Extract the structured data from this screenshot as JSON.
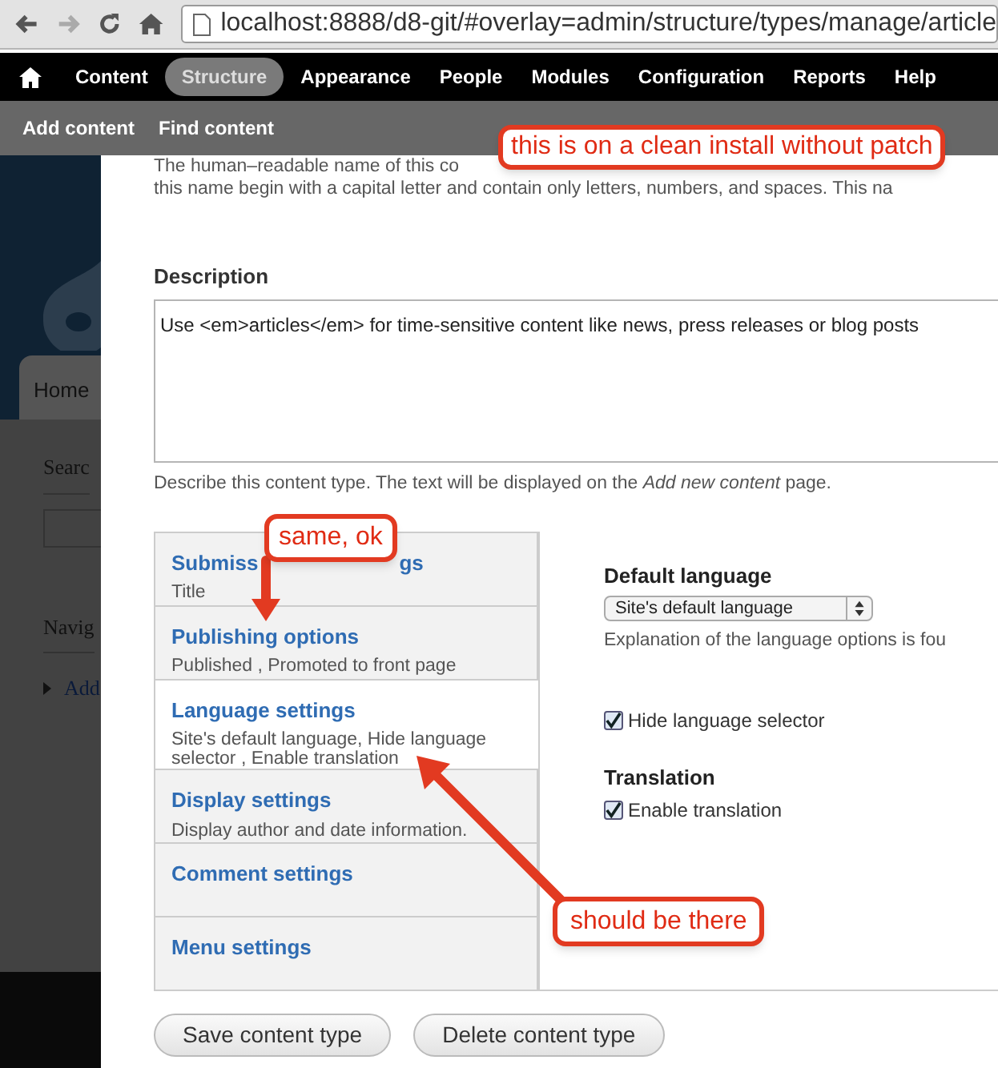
{
  "browser": {
    "url": "localhost:8888/d8-git/#overlay=admin/structure/types/manage/article"
  },
  "toolbar": {
    "items": [
      {
        "label": "Content",
        "selected": false
      },
      {
        "label": "Structure",
        "selected": true
      },
      {
        "label": "Appearance",
        "selected": false
      },
      {
        "label": "People",
        "selected": false
      },
      {
        "label": "Modules",
        "selected": false
      },
      {
        "label": "Configuration",
        "selected": false
      },
      {
        "label": "Reports",
        "selected": false
      },
      {
        "label": "Help",
        "selected": false
      }
    ]
  },
  "shortcuts": [
    "Add content",
    "Find content"
  ],
  "background_site": {
    "tab": "Home",
    "search_heading": "Searc",
    "navigation_heading": "Navig",
    "link": "Add"
  },
  "form": {
    "name_help": [
      "The human–readable name of this co",
      "this name begin with a capital letter and contain only letters, numbers, and spaces. This na"
    ],
    "description_label": "Description",
    "description_value": "Use <em>articles</em> for time-sensitive content like news, press releases or blog posts",
    "description_hint": "Describe this content type. The text will be displayed on the *Add new content* page."
  },
  "vertical_tabs": [
    {
      "title": "Submiss",
      "title_end": "gs",
      "summary": "Title",
      "selected": false
    },
    {
      "title": "Publishing options",
      "summary": "Published , Promoted to front page",
      "selected": false
    },
    {
      "title": "Language settings",
      "summary": "Site's default language, Hide language selector , Enable translation",
      "selected": true
    },
    {
      "title": "Display settings",
      "summary": "Display author and date information.",
      "selected": false
    },
    {
      "title": "Comment settings",
      "selected": false
    },
    {
      "title": "Menu settings",
      "selected": false
    }
  ],
  "language_pane": {
    "default_language_label": "Default language",
    "select_value": "Site's default language",
    "explanation": "Explanation of the language options is fou",
    "hide_selector": {
      "label": "Hide language selector",
      "checked": true
    },
    "translation_heading": "Translation",
    "enable_translation": {
      "label": "Enable translation",
      "checked": true
    }
  },
  "buttons": [
    "Save content type",
    "Delete content type"
  ],
  "annotations": [
    "this is on a clean install without patch",
    "same, ok",
    "should be there"
  ]
}
